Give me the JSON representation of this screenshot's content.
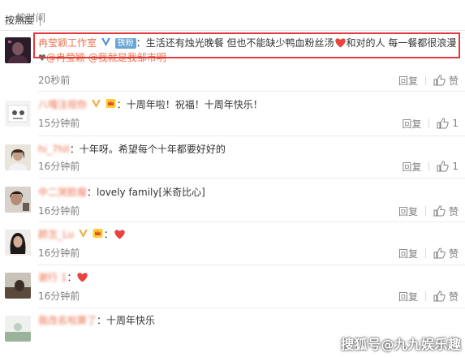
{
  "sort": {
    "hot_label": "按热度",
    "time_label": "按时间"
  },
  "comments": [
    {
      "user": "冉莹颖工作室",
      "fan_badge": "铁粉",
      "text": "生活还有烛光晚餐 但也不能缺少鸭血粉丝汤",
      "text2": "和对的人 每一餐都很浪漫",
      "mention1": "@冉莹颖",
      "mention2": "@我就是我邹市明",
      "time": "20秒前",
      "reply": "回复",
      "like": "赞"
    },
    {
      "user": "八嘎注视你",
      "text": "十周年啦！祝福！十周年快乐！",
      "time": "15分钟前",
      "reply": "回复",
      "likes": "1"
    },
    {
      "user": "hi_7hll",
      "text": "十年呀。希望每个十年都要好好的",
      "time": "16分钟前",
      "reply": "回复",
      "likes": "1"
    },
    {
      "user": "中二哭脸瘦",
      "text": "lovely family[米奇比心]",
      "time": "16分钟前",
      "reply": "回复",
      "like": "赞"
    },
    {
      "user": "颜怎_Lu",
      "time": "16分钟前",
      "reply": "回复",
      "like": "赞"
    },
    {
      "user": "谢行 1",
      "time": "16分钟前",
      "reply": "回复",
      "like": "赞"
    },
    {
      "user": "我改名啦算了",
      "text": "十周年快乐",
      "time": "",
      "reply": "",
      "like": ""
    }
  ],
  "watermark": "搜狐号@九九娱乐趣",
  "colors": {
    "username": "#eb7350",
    "highlight_box": "#e4393c",
    "meta_text": "#808080"
  }
}
